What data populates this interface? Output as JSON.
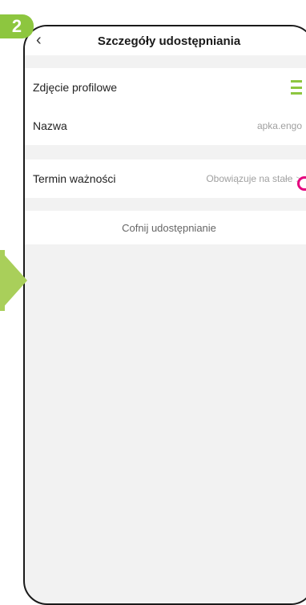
{
  "step_number": "2",
  "header": {
    "title": "Szczegóły udostępniania",
    "back_icon": "chevron-left-icon"
  },
  "rows": {
    "profile_photo_label": "Zdjęcie profilowe",
    "name_label": "Nazwa",
    "name_value": "apka.engo",
    "expiry_label": "Termin ważności",
    "expiry_value": "Obowiązuje na stałe",
    "expiry_chevron": ">"
  },
  "actions": {
    "revoke_label": "Cofnij udostępnianie"
  },
  "colors": {
    "accent_green": "#8dc63f",
    "highlight_pink": "#e5007e"
  }
}
